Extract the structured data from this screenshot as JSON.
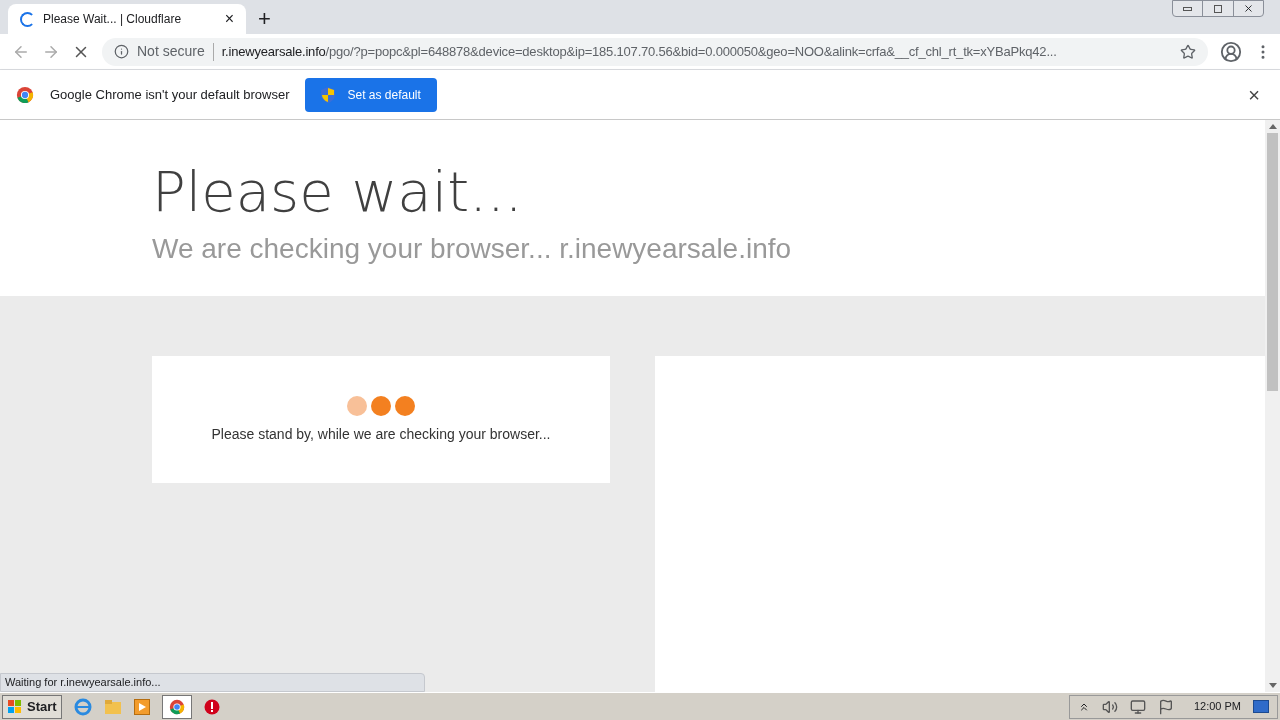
{
  "tab": {
    "title": "Please Wait... | Cloudflare",
    "close": "×",
    "loading": true
  },
  "new_tab": "+",
  "address_bar": {
    "security": "Not secure",
    "host": "r.inewyearsale.info",
    "path": "/pgo/?p=popc&pl=648878&device=desktop&ip=185.107.70.56&bid=0.000050&geo=NOO&alink=crfa&__cf_chl_rt_tk=xYBaPkq42..."
  },
  "infobar": {
    "message": "Google Chrome isn't your default browser",
    "button": "Set as default",
    "close": "×"
  },
  "page": {
    "title": "Please wait...",
    "subtitle": "We are checking your browser... r.inewyearsale.info",
    "dots": [
      {
        "active": false
      },
      {
        "active": true
      },
      {
        "active": true
      }
    ],
    "message": "Please stand by, while we are checking your browser..."
  },
  "status_bubble": "Waiting for r.inewyearsale.info...",
  "taskbar": {
    "start": "Start",
    "clock": "12:00 PM"
  }
}
